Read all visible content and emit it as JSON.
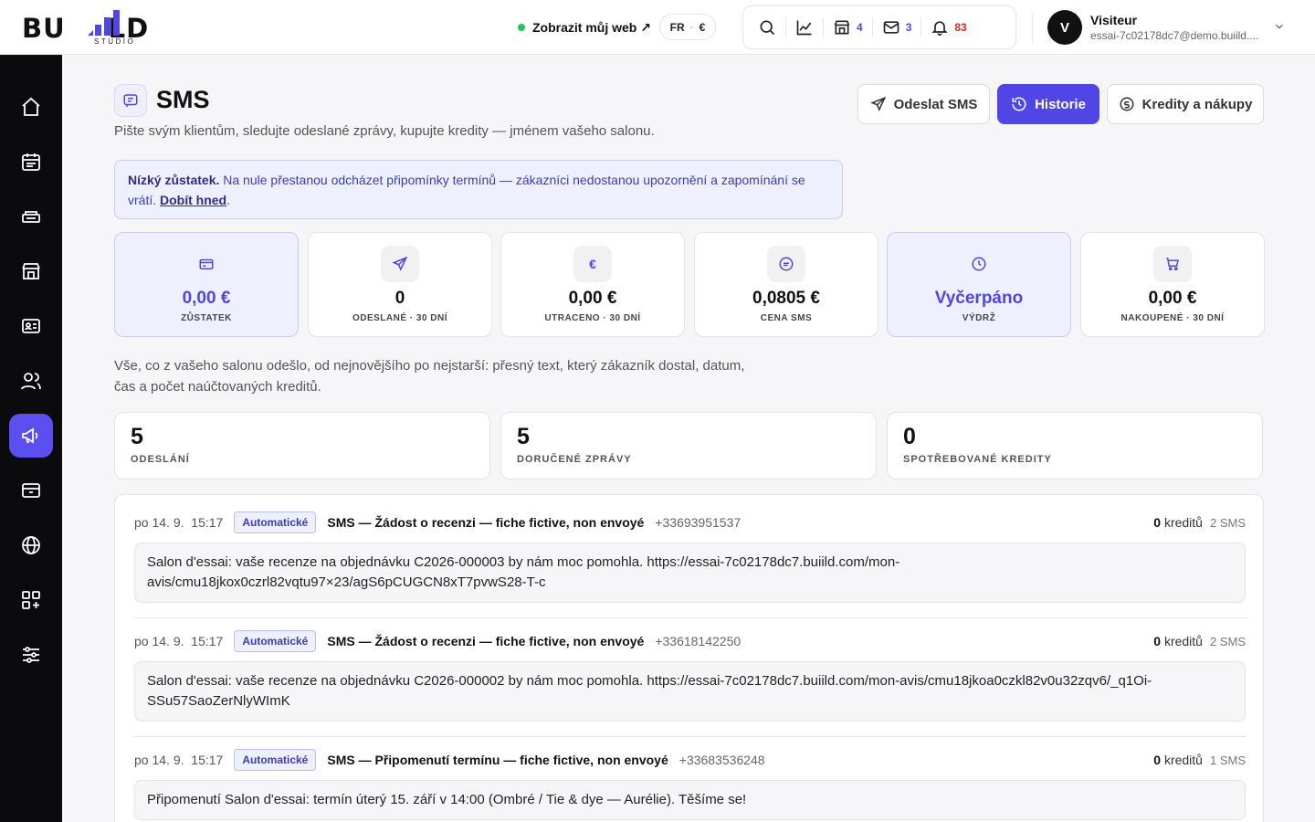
{
  "brand": {
    "word_left": "BU",
    "word_right": "LD",
    "tagline": "STUDIO"
  },
  "header": {
    "view_site": "Zobrazit můj web ↗",
    "lang": "FR",
    "currency": "€",
    "counts": {
      "stores": "4",
      "mail": "3",
      "notifications": "83"
    },
    "user": {
      "initial": "V",
      "name": "Visiteur",
      "email": "essai-7c02178dc7@demo.buiild...."
    }
  },
  "sidebar": {
    "items": [
      {
        "name": "home",
        "active": false
      },
      {
        "name": "calendar",
        "active": false
      },
      {
        "name": "services",
        "active": false
      },
      {
        "name": "store",
        "active": false
      },
      {
        "name": "contact-card",
        "active": false
      },
      {
        "name": "clients",
        "active": false
      },
      {
        "name": "sms",
        "active": true
      },
      {
        "name": "payments",
        "active": false
      },
      {
        "name": "website",
        "active": false
      },
      {
        "name": "apps",
        "active": false
      },
      {
        "name": "settings",
        "active": false
      }
    ]
  },
  "page": {
    "title": "SMS",
    "subtitle": "Pište svým klientům, sledujte odeslané zprávy, kupujte kredity — jménem vašeho salonu.",
    "buttons": {
      "send": "Odeslat SMS",
      "history": "Historie",
      "credits": "Kredity a nákupy"
    },
    "alert": {
      "strong": "Nízký zůstatek.",
      "text": " Na nule přestanou odcházet připomínky termínů — zákazníci nedostanou upozornění a zapomínání se vrátí. ",
      "link": "Dobít hned",
      "end": "."
    },
    "stats": [
      {
        "icon": "card-icon",
        "value": "0,00 €",
        "label": "ZŮSTATEK",
        "highlight": true
      },
      {
        "icon": "send-icon",
        "value": "0",
        "label": "ODESLANÉ · 30 DNÍ",
        "highlight": false
      },
      {
        "icon": "euro-icon",
        "value": "0,00 €",
        "label": "UTRACENO · 30 DNÍ",
        "highlight": false
      },
      {
        "icon": "message-icon",
        "value": "0,0805 €",
        "label": "CENA SMS",
        "highlight": false
      },
      {
        "icon": "clock-icon",
        "value": "Vyčerpáno",
        "label": "VÝDRŽ",
        "highlight": true
      },
      {
        "icon": "cart-icon",
        "value": "0,00 €",
        "label": "NAKOUPENÉ · 30 DNÍ",
        "highlight": false
      }
    ],
    "description": "Vše, co z vašeho salonu odešlo, od nejnovějšího po nejstarší: přesný text, který zákazník dostal, datum, čas a počet naúčtovaných kreditů.",
    "kpis": [
      {
        "value": "5",
        "label": "ODESLÁNÍ"
      },
      {
        "value": "5",
        "label": "DORUČENÉ ZPRÁVY"
      },
      {
        "value": "0",
        "label": "SPOTŘEBOVANÉ KREDITY"
      }
    ],
    "history": [
      {
        "date": "po 14. 9.",
        "time": "15:17",
        "badge": "Automatické",
        "subject": "SMS — Žádost o recenzi — fiche fictive, non envoyé",
        "phone": "+33693951537",
        "credits_num": "0",
        "credits_word": " kreditů",
        "sms_count": "2 SMS",
        "message": "Salon d'essai: vaše recenze na objednávku C2026-000003 by nám moc pomohla. https://essai-7c02178dc7.buiild.com/mon-avis/cmu18jkox0czrl82vqtu97×23/agS6pCUGCN8xT7pvwS28-T-c"
      },
      {
        "date": "po 14. 9.",
        "time": "15:17",
        "badge": "Automatické",
        "subject": "SMS — Žádost o recenzi — fiche fictive, non envoyé",
        "phone": "+33618142250",
        "credits_num": "0",
        "credits_word": " kreditů",
        "sms_count": "2 SMS",
        "message": "Salon d'essai: vaše recenze na objednávku C2026-000002 by nám moc pomohla. https://essai-7c02178dc7.buiild.com/mon-avis/cmu18jkoa0czkl82v0u32zqv6/_q1Oi-SSu57SaoZerNlyWImK"
      },
      {
        "date": "po 14. 9.",
        "time": "15:17",
        "badge": "Automatické",
        "subject": "SMS — Připomenutí termínu — fiche fictive, non envoyé",
        "phone": "+33683536248",
        "credits_num": "0",
        "credits_word": " kreditů",
        "sms_count": "1 SMS",
        "message": "Připomenutí Salon d'essai: termín úterý 15. září v 14:00 (Ombré / Tie & dye — Aurélie). Těšíme se!"
      }
    ]
  }
}
